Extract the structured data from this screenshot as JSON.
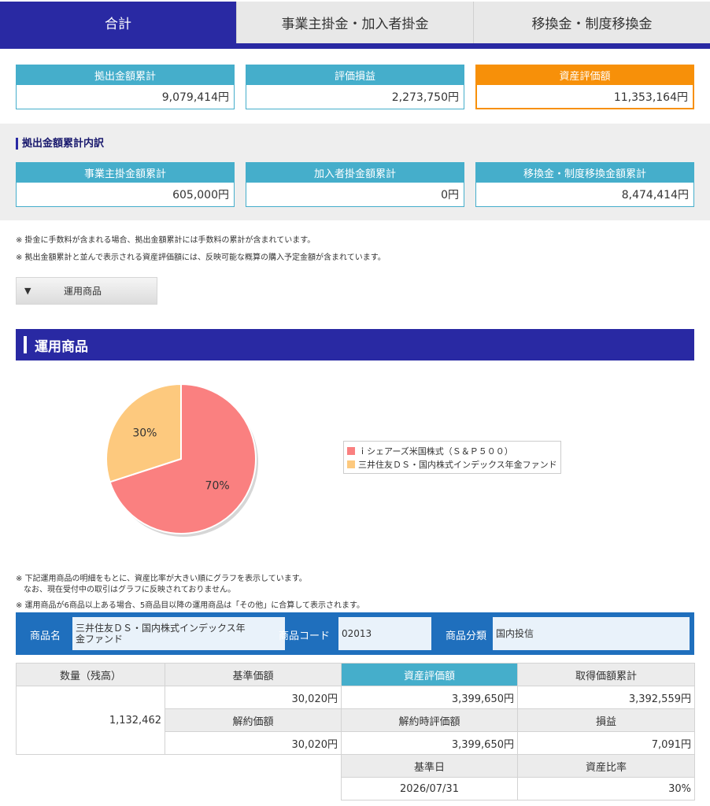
{
  "tabs": [
    {
      "label": "合計"
    },
    {
      "label": "事業主掛金・加入者掛金"
    },
    {
      "label": "移換金・制度移換金"
    }
  ],
  "summary": {
    "contribution_total": {
      "label": "拠出金額累計",
      "value": "9,079,414円"
    },
    "valuation_gain": {
      "label": "評価損益",
      "value": "2,273,750円"
    },
    "asset_value": {
      "label": "資産評価額",
      "value": "11,353,164円"
    }
  },
  "breakdown": {
    "title": "拠出金額累計内訳",
    "employer": {
      "label": "事業主掛金額累計",
      "value": "605,000円"
    },
    "member": {
      "label": "加入者掛金額累計",
      "value": "0円"
    },
    "transfer": {
      "label": "移換金・制度移換金額累計",
      "value": "8,474,414円"
    }
  },
  "notes": {
    "n1": "※ 掛金に手数料が含まれる場合、拠出金額累計には手数料の累計が含まれています。",
    "n2": "※ 拠出金額累計と並んで表示される資産評価額には、反映可能な概算の購入予定金額が含まれています。",
    "n3": "※ 下記運用商品の明細をもとに、資産比率が大きい順にグラフを表示しています。",
    "n4": "　なお、現在受付中の取引はグラフに反映されておりません。",
    "n5": "※ 運用商品が6商品以上ある場合、5商品目以降の運用商品は「その他」に合算して表示されます。"
  },
  "toggle": {
    "arrow": "▼",
    "label": "運用商品"
  },
  "section_title": "運用商品",
  "chart_data": {
    "type": "pie",
    "slices": [
      {
        "name": "ｉシェアーズ米国株式（Ｓ＆Ｐ５００）",
        "value": 70,
        "label": "70%",
        "color": "#fa8080"
      },
      {
        "name": "三井住友ＤＳ・国内株式インデックス年金ファンド",
        "value": 30,
        "label": "30%",
        "color": "#fdc97e"
      }
    ],
    "legend_position": "right"
  },
  "product": {
    "name_label": "商品名",
    "name_line1": "三井住友ＤＳ・国内株式インデックス年",
    "name_line2": "金ファンド",
    "code_label": "商品コード",
    "code": "02013",
    "category_label": "商品分類",
    "category": "国内投信"
  },
  "detail": {
    "quantity_label": "数量（残高）",
    "quantity": "1,132,462",
    "base_price_label": "基準価額",
    "base_price": "30,020円",
    "asset_value_label": "資産評価額",
    "asset_value": "3,399,650円",
    "acq_total_label": "取得価額累計",
    "acq_total": "3,392,559円",
    "cancel_price_label": "解約価額",
    "cancel_price": "30,020円",
    "cancel_value_label": "解約時評価額",
    "cancel_value": "3,399,650円",
    "pnl_label": "損益",
    "pnl": "7,091円",
    "base_date_label": "基準日",
    "base_date": "2026/07/31",
    "ratio_label": "資産比率",
    "ratio": "30%"
  }
}
